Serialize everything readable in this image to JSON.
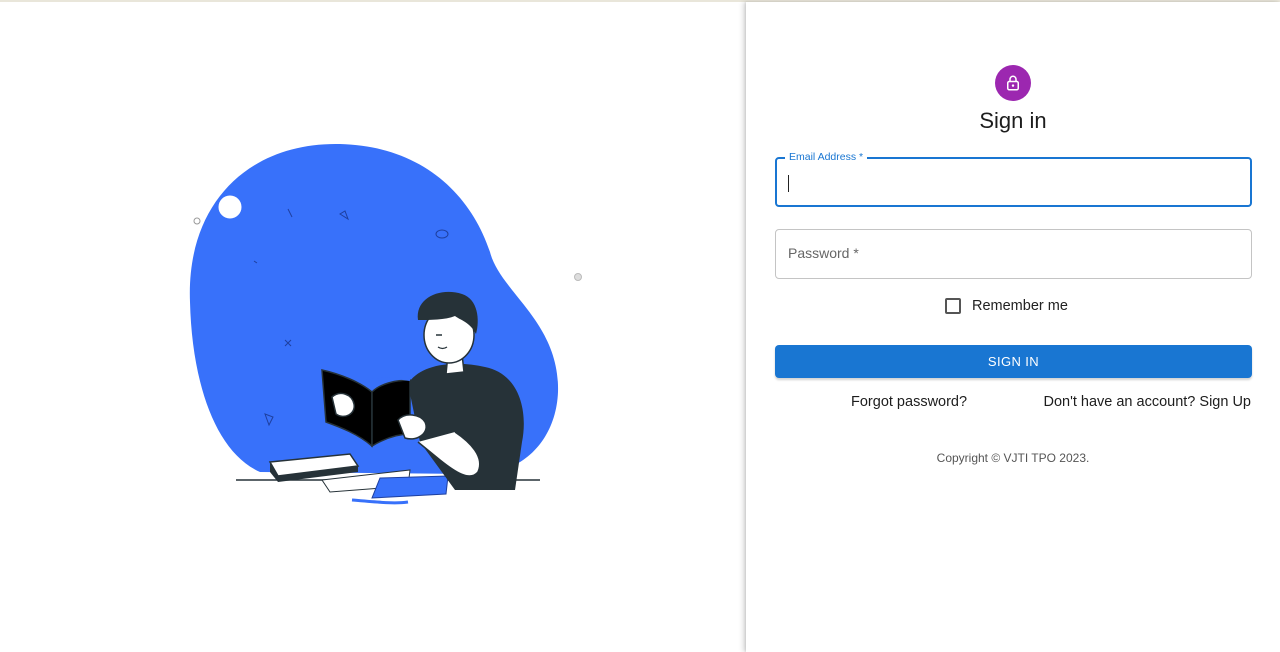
{
  "signin": {
    "title": "Sign in",
    "email_label": "Email Address *",
    "email_value": "",
    "password_label": "Password *",
    "password_value": "",
    "remember_label": "Remember me",
    "button_label": "SIGN IN",
    "forgot_link": "Forgot password?",
    "signup_link": "Don't have an account? Sign Up",
    "copyright": "Copyright © VJTI TPO 2023."
  },
  "icons": {
    "avatar": "lock-icon"
  },
  "colors": {
    "accent": "#1976d2",
    "avatar_bg": "#9c27b0",
    "blob": "#3871fa",
    "ink": "#263238"
  }
}
